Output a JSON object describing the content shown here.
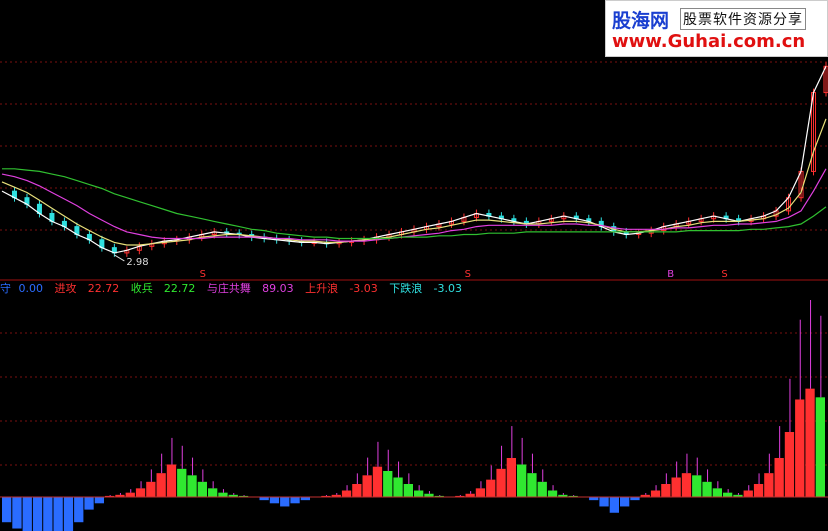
{
  "logo": {
    "brand": "股海网",
    "tagline": "股票软件资源分享",
    "url": "www.Guhai.com.cn"
  },
  "legend": {
    "items": [
      {
        "label": "守",
        "value": "0.00",
        "color": "#2a6cff"
      },
      {
        "label": "进攻",
        "value": "22.72",
        "color": "#ff3030"
      },
      {
        "label": "收兵",
        "value": "22.72",
        "color": "#30e830"
      },
      {
        "label": "与庄共舞",
        "value": "89.03",
        "color": "#e040e0"
      },
      {
        "label": "上升浪",
        "value": "-3.03",
        "color": "#ff3030"
      },
      {
        "label": "下跌浪",
        "value": "-3.03",
        "color": "#30e0e0"
      }
    ]
  },
  "chart_data": [
    {
      "type": "line",
      "panel": "price",
      "annotations": [
        {
          "text": "2.98",
          "note": "low marker"
        }
      ],
      "signal_markers": [
        {
          "glyph": "S"
        },
        {
          "glyph": "S"
        },
        {
          "glyph": "S"
        },
        {
          "glyph": "B"
        }
      ],
      "series": [
        {
          "color": "#ffffff",
          "values": [
            3.45,
            3.4,
            3.35,
            3.28,
            3.22,
            3.18,
            3.12,
            3.08,
            3.02,
            2.98,
            3.0,
            3.03,
            3.05,
            3.07,
            3.08,
            3.1,
            3.12,
            3.14,
            3.13,
            3.12,
            3.1,
            3.09,
            3.08,
            3.07,
            3.06,
            3.06,
            3.05,
            3.06,
            3.07,
            3.08,
            3.1,
            3.12,
            3.14,
            3.16,
            3.18,
            3.2,
            3.22,
            3.25,
            3.28,
            3.26,
            3.24,
            3.22,
            3.2,
            3.22,
            3.24,
            3.26,
            3.24,
            3.22,
            3.18,
            3.14,
            3.12,
            3.13,
            3.15,
            3.18,
            3.2,
            3.22,
            3.24,
            3.26,
            3.24,
            3.22,
            3.24,
            3.26,
            3.3,
            3.4,
            3.6,
            4.2,
            4.4
          ]
        },
        {
          "color": "#e8e07a",
          "values": [
            3.52,
            3.48,
            3.44,
            3.38,
            3.32,
            3.26,
            3.2,
            3.15,
            3.1,
            3.06,
            3.04,
            3.04,
            3.05,
            3.06,
            3.07,
            3.08,
            3.1,
            3.11,
            3.12,
            3.12,
            3.11,
            3.1,
            3.09,
            3.08,
            3.07,
            3.07,
            3.06,
            3.06,
            3.07,
            3.08,
            3.09,
            3.1,
            3.12,
            3.14,
            3.16,
            3.17,
            3.19,
            3.21,
            3.23,
            3.23,
            3.22,
            3.21,
            3.2,
            3.2,
            3.21,
            3.22,
            3.22,
            3.21,
            3.19,
            3.16,
            3.14,
            3.14,
            3.15,
            3.16,
            3.18,
            3.19,
            3.21,
            3.22,
            3.22,
            3.22,
            3.23,
            3.24,
            3.27,
            3.32,
            3.44,
            3.75,
            4.0
          ]
        },
        {
          "color": "#e040e0",
          "values": [
            3.58,
            3.56,
            3.53,
            3.49,
            3.44,
            3.39,
            3.34,
            3.28,
            3.23,
            3.18,
            3.14,
            3.12,
            3.1,
            3.09,
            3.09,
            3.09,
            3.09,
            3.1,
            3.1,
            3.1,
            3.1,
            3.1,
            3.09,
            3.09,
            3.08,
            3.08,
            3.08,
            3.07,
            3.07,
            3.07,
            3.08,
            3.09,
            3.1,
            3.11,
            3.12,
            3.13,
            3.15,
            3.16,
            3.18,
            3.19,
            3.19,
            3.19,
            3.19,
            3.19,
            3.19,
            3.2,
            3.2,
            3.19,
            3.19,
            3.17,
            3.16,
            3.16,
            3.16,
            3.16,
            3.17,
            3.17,
            3.18,
            3.19,
            3.19,
            3.2,
            3.2,
            3.21,
            3.22,
            3.25,
            3.3,
            3.45,
            3.62
          ]
        },
        {
          "color": "#30c030",
          "values": [
            3.62,
            3.62,
            3.61,
            3.6,
            3.58,
            3.56,
            3.53,
            3.5,
            3.47,
            3.43,
            3.4,
            3.37,
            3.34,
            3.31,
            3.28,
            3.26,
            3.24,
            3.22,
            3.2,
            3.18,
            3.16,
            3.15,
            3.13,
            3.12,
            3.11,
            3.1,
            3.1,
            3.09,
            3.09,
            3.09,
            3.09,
            3.09,
            3.1,
            3.1,
            3.1,
            3.11,
            3.11,
            3.12,
            3.12,
            3.13,
            3.13,
            3.13,
            3.14,
            3.14,
            3.14,
            3.14,
            3.14,
            3.14,
            3.14,
            3.14,
            3.14,
            3.14,
            3.14,
            3.14,
            3.14,
            3.15,
            3.15,
            3.15,
            3.15,
            3.15,
            3.16,
            3.16,
            3.17,
            3.18,
            3.2,
            3.26,
            3.33
          ]
        }
      ],
      "ylim": [
        2.85,
        4.6
      ]
    },
    {
      "type": "bar",
      "panel": "indicator",
      "series": [
        {
          "name": "进攻",
          "color": "#ff3030"
        },
        {
          "name": "收兵",
          "color": "#30e830"
        },
        {
          "name": "与庄共舞",
          "color": "#e040e0"
        },
        {
          "name": "守",
          "color": "#2a6cff"
        }
      ],
      "values": [
        -8,
        -10,
        -12,
        -14,
        -15,
        -14,
        -12,
        -8,
        -4,
        -2,
        1,
        2,
        4,
        8,
        14,
        22,
        30,
        26,
        20,
        14,
        8,
        4,
        2,
        1,
        0,
        -1,
        -2,
        -3,
        -2,
        -1,
        0,
        1,
        2,
        6,
        12,
        20,
        28,
        24,
        18,
        12,
        6,
        3,
        1,
        0,
        1,
        3,
        8,
        16,
        26,
        36,
        30,
        22,
        14,
        6,
        2,
        1,
        0,
        -1,
        -3,
        -5,
        -3,
        -1,
        2,
        6,
        12,
        18,
        22,
        20,
        14,
        8,
        4,
        2,
        6,
        12,
        22,
        36,
        60,
        90,
        100,
        92
      ],
      "ylim": [
        -20,
        100
      ]
    }
  ]
}
